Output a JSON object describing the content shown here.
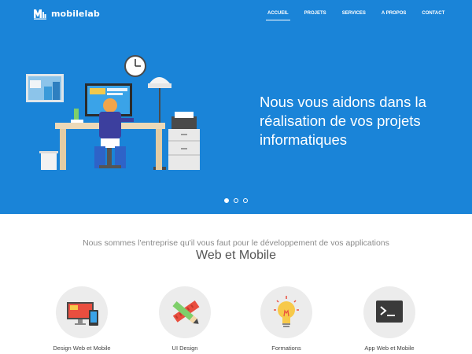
{
  "brand": {
    "name": "mobilelab"
  },
  "nav": {
    "items": [
      {
        "label": "ACCUEIL",
        "active": true
      },
      {
        "label": "PROJETS",
        "active": false
      },
      {
        "label": "SERVICES",
        "active": false
      },
      {
        "label": "A PROPOS",
        "active": false
      },
      {
        "label": "CONTACT",
        "active": false
      }
    ]
  },
  "hero": {
    "headline": "Nous vous aidons dans la réalisation de vos projets informatiques",
    "slide_count": 3,
    "active_slide": 1
  },
  "intro": {
    "tagline": "Nous sommes l'entreprise qu'il vous faut pour le développement de vos applications",
    "subhead": "Web et Mobile"
  },
  "features": [
    {
      "label": "Design Web et Mobile",
      "icon": "devices-icon"
    },
    {
      "label": "UI Design",
      "icon": "pencil-ruler-icon"
    },
    {
      "label": "Formations",
      "icon": "lightbulb-icon"
    },
    {
      "label": "App Web et Mobile",
      "icon": "terminal-icon"
    }
  ],
  "colors": {
    "hero_bg": "#1a84d8",
    "circle_bg": "#ececec",
    "text_muted": "#8a8a8a"
  }
}
